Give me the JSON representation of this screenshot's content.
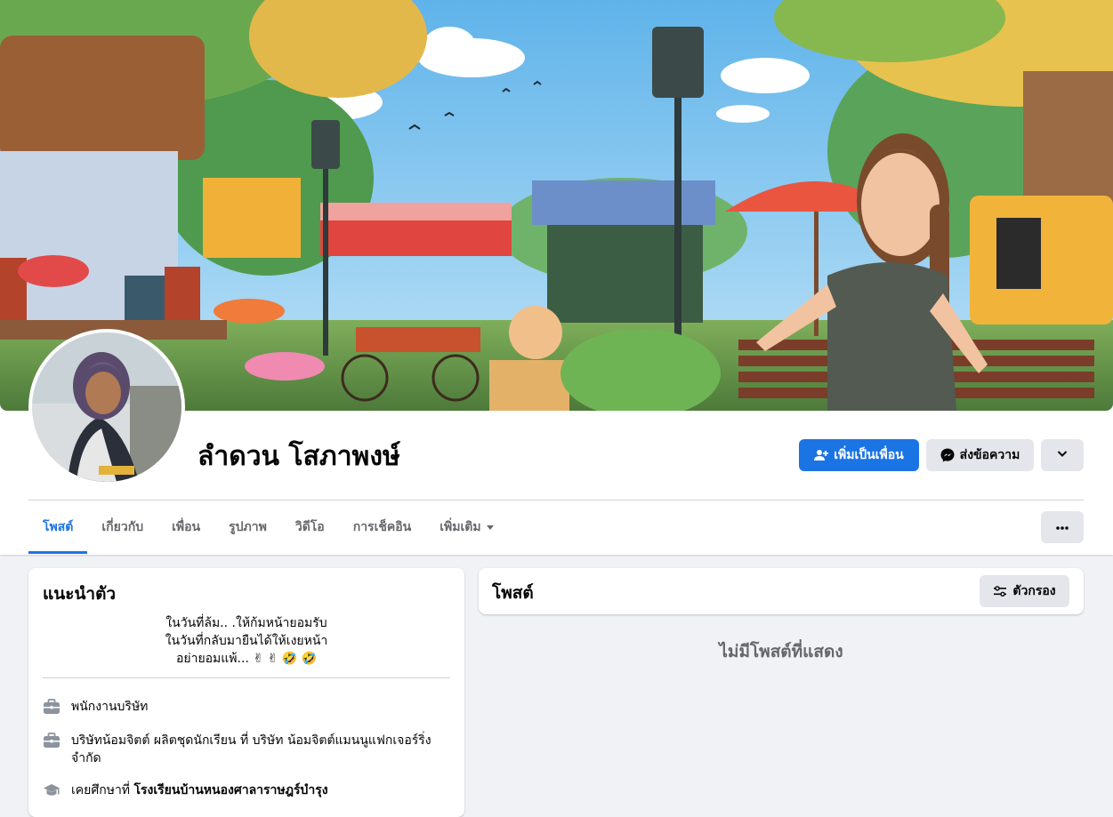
{
  "profile": {
    "name": "ลำดวน โสภาพงษ์"
  },
  "actions": {
    "add_friend": "เพิ่มเป็นเพื่อน",
    "message": "ส่งข้อความ"
  },
  "tabs": [
    {
      "label": "โพสต์"
    },
    {
      "label": "เกี่ยวกับ"
    },
    {
      "label": "เพื่อน"
    },
    {
      "label": "รูปภาพ"
    },
    {
      "label": "วิดีโอ"
    },
    {
      "label": "การเช็คอิน"
    },
    {
      "label": "เพิ่มเติม"
    }
  ],
  "intro": {
    "title": "แนะนำตัว",
    "bio_lines": [
      "ในวันที่ล้ม.. .ให้ก้มหน้ายอมรับ",
      "ในวันที่กลับมายืนได้ให้เงยหน้า",
      "อย่ายอมแพ้... ✌ ✌ 🤣 🤣"
    ],
    "work1": "พนักงานบริษัท",
    "work2": "บริษัทน้อมจิตต์ ผลิตชุดนักเรียน ที่ บริษัท น้อมจิตต์แมนนูแฟกเจอร์ริ่ง จำกัด",
    "edu_prefix": "เคยศึกษาที่ ",
    "edu_school": "โรงเรียนบ้านหนองศาลาราษฎร์บำรุง"
  },
  "posts": {
    "title": "โพสต์",
    "filter_label": "ตัวกรอง",
    "empty_text": "ไม่มีโพสต์ที่แสดง"
  },
  "colors": {
    "accent": "#1b74e4",
    "background": "#f0f2f5",
    "secondary_button": "#e4e6eb",
    "muted_text": "#65676b"
  },
  "icons": {
    "add_friend": "person-plus-icon",
    "message": "messenger-icon",
    "dropdown": "chevron-down-icon",
    "more": "ellipsis-icon",
    "filter": "sliders-icon",
    "work": "briefcase-icon",
    "education": "graduation-cap-icon"
  }
}
